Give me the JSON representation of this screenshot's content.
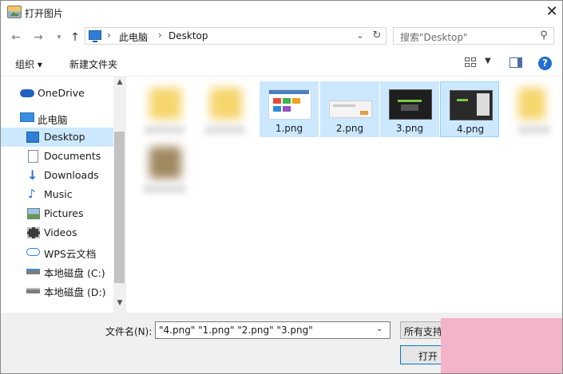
{
  "window": {
    "title": "打开图片"
  },
  "address": {
    "crumbs": [
      "此电脑",
      "Desktop"
    ]
  },
  "search": {
    "placeholder": "搜索\"Desktop\""
  },
  "toolbar": {
    "organize": "组织 ▾",
    "new_folder": "新建文件夹"
  },
  "sidebar": {
    "items": [
      {
        "label": "OneDrive",
        "icon": "cloud-icon"
      },
      {
        "label": "此电脑",
        "icon": "computer-icon"
      },
      {
        "label": "Desktop",
        "icon": "desktop-icon",
        "selected": true
      },
      {
        "label": "Documents",
        "icon": "documents-icon"
      },
      {
        "label": "Downloads",
        "icon": "download-icon"
      },
      {
        "label": "Music",
        "icon": "music-icon"
      },
      {
        "label": "Pictures",
        "icon": "pictures-icon"
      },
      {
        "label": "Videos",
        "icon": "videos-icon"
      },
      {
        "label": "WPS云文档",
        "icon": "wps-cloud-icon"
      },
      {
        "label": "本地磁盘 (C:)",
        "icon": "drive-icon"
      },
      {
        "label": "本地磁盘 (D:)",
        "icon": "drive-icon"
      }
    ]
  },
  "files": {
    "items": [
      {
        "name": "1.png",
        "selected": true
      },
      {
        "name": "2.png",
        "selected": true
      },
      {
        "name": "3.png",
        "selected": true
      },
      {
        "name": "4.png",
        "selected": true
      }
    ]
  },
  "footer": {
    "filename_label": "文件名(N):",
    "filename_value": "\"4.png\" \"1.png\" \"2.png\" \"3.png\"",
    "filetype_value": "所有支持的",
    "open_label": "打开"
  },
  "colors": {
    "selection": "#cce8ff",
    "accent": "#0078d7",
    "watermark": "#f3b3c9"
  }
}
